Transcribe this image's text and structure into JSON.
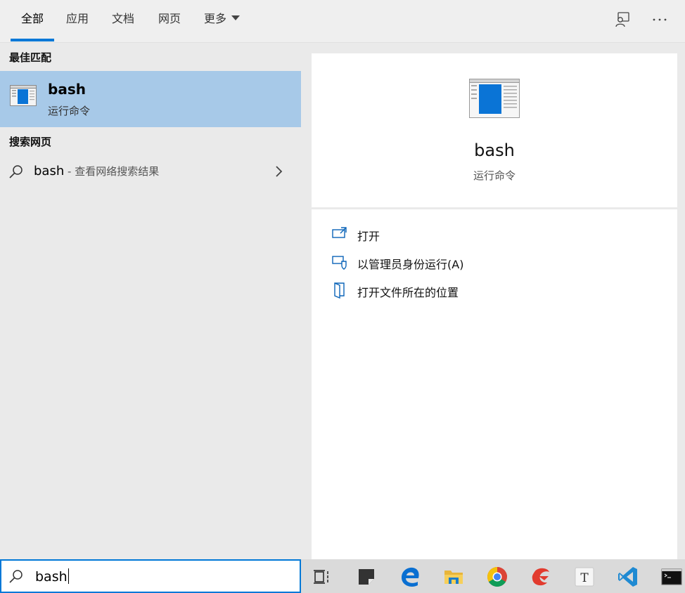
{
  "tabs": [
    {
      "label": "全部",
      "active": true
    },
    {
      "label": "应用"
    },
    {
      "label": "文档"
    },
    {
      "label": "网页"
    },
    {
      "label": "更多"
    }
  ],
  "top_icons": [
    "feedback-icon",
    "more-options-icon"
  ],
  "best_match": {
    "section_title": "最佳匹配",
    "name": "bash",
    "subtitle": "运行命令"
  },
  "web_search": {
    "section_title": "搜索网页",
    "query": "bash",
    "suffix": " - 查看网络搜索结果"
  },
  "preview": {
    "title": "bash",
    "subtitle": "运行命令"
  },
  "actions": [
    {
      "label": "打开",
      "icon": "open-icon"
    },
    {
      "label": "以管理员身份运行(A)",
      "icon": "run-as-admin-icon"
    },
    {
      "label": "打开文件所在的位置",
      "icon": "open-file-location-icon"
    }
  ],
  "search_box": {
    "value": "bash"
  },
  "taskbar_icons": [
    "task-view-icon",
    "sticky-notes-icon",
    "edge-icon",
    "file-explorer-icon",
    "chrome-icon",
    "wps-icon",
    "typora-icon",
    "vscode-icon",
    "terminal-icon"
  ],
  "colors": {
    "accent": "#0078d7",
    "selected_item": "#a7c9e8"
  }
}
